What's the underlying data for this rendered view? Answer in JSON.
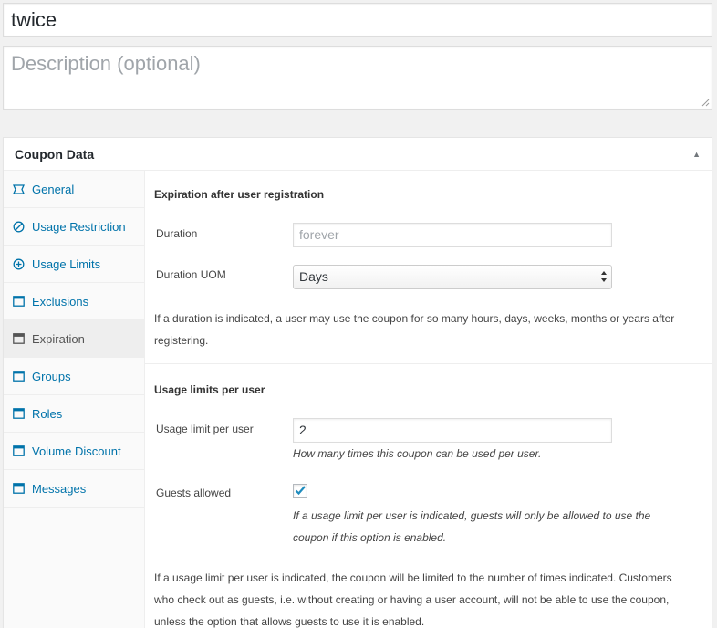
{
  "title_field": {
    "value": "twice"
  },
  "description_field": {
    "placeholder": "Description (optional)"
  },
  "postbox": {
    "title": "Coupon Data",
    "toggle_icon": "triangle-up-icon"
  },
  "tabs": [
    {
      "label": "General",
      "icon": "ticket-icon",
      "active": false
    },
    {
      "label": "Usage Restriction",
      "icon": "no-entry-icon",
      "active": false
    },
    {
      "label": "Usage Limits",
      "icon": "plus-circle-icon",
      "active": false
    },
    {
      "label": "Exclusions",
      "icon": "window-icon",
      "active": false
    },
    {
      "label": "Expiration",
      "icon": "window-icon",
      "active": true
    },
    {
      "label": "Groups",
      "icon": "window-icon",
      "active": false
    },
    {
      "label": "Roles",
      "icon": "window-icon",
      "active": false
    },
    {
      "label": "Volume Discount",
      "icon": "window-icon",
      "active": false
    },
    {
      "label": "Messages",
      "icon": "window-icon",
      "active": false
    }
  ],
  "expiration": {
    "heading": "Expiration after user registration",
    "duration_label": "Duration",
    "duration_placeholder": "forever",
    "uom_label": "Duration UOM",
    "uom_value": "Days",
    "help_line1": "If a duration is indicated, a user may use the coupon for so many hours, days, weeks, months or years after",
    "help_line2": "registering."
  },
  "usage_limits": {
    "heading": "Usage limits per user",
    "limit_label": "Usage limit per user",
    "limit_value": "2",
    "limit_desc": "How many times this coupon can be used per user.",
    "guests_label": "Guests allowed",
    "guests_checked": true,
    "guests_desc_line1": "If a usage limit per user is indicated, guests will only be allowed to use the",
    "guests_desc_line2": "coupon if this option is enabled.",
    "help_line1": "If a usage limit per user is indicated, the coupon will be limited to the number of times indicated. Customers",
    "help_line2": "who check out as guests, i.e. without creating or having a user account, will not be able to use the coupon,",
    "help_line3": "unless the option that allows guests to use it is enabled."
  },
  "colors": {
    "link": "#0073aa",
    "checkmark": "#1e8cbe"
  }
}
